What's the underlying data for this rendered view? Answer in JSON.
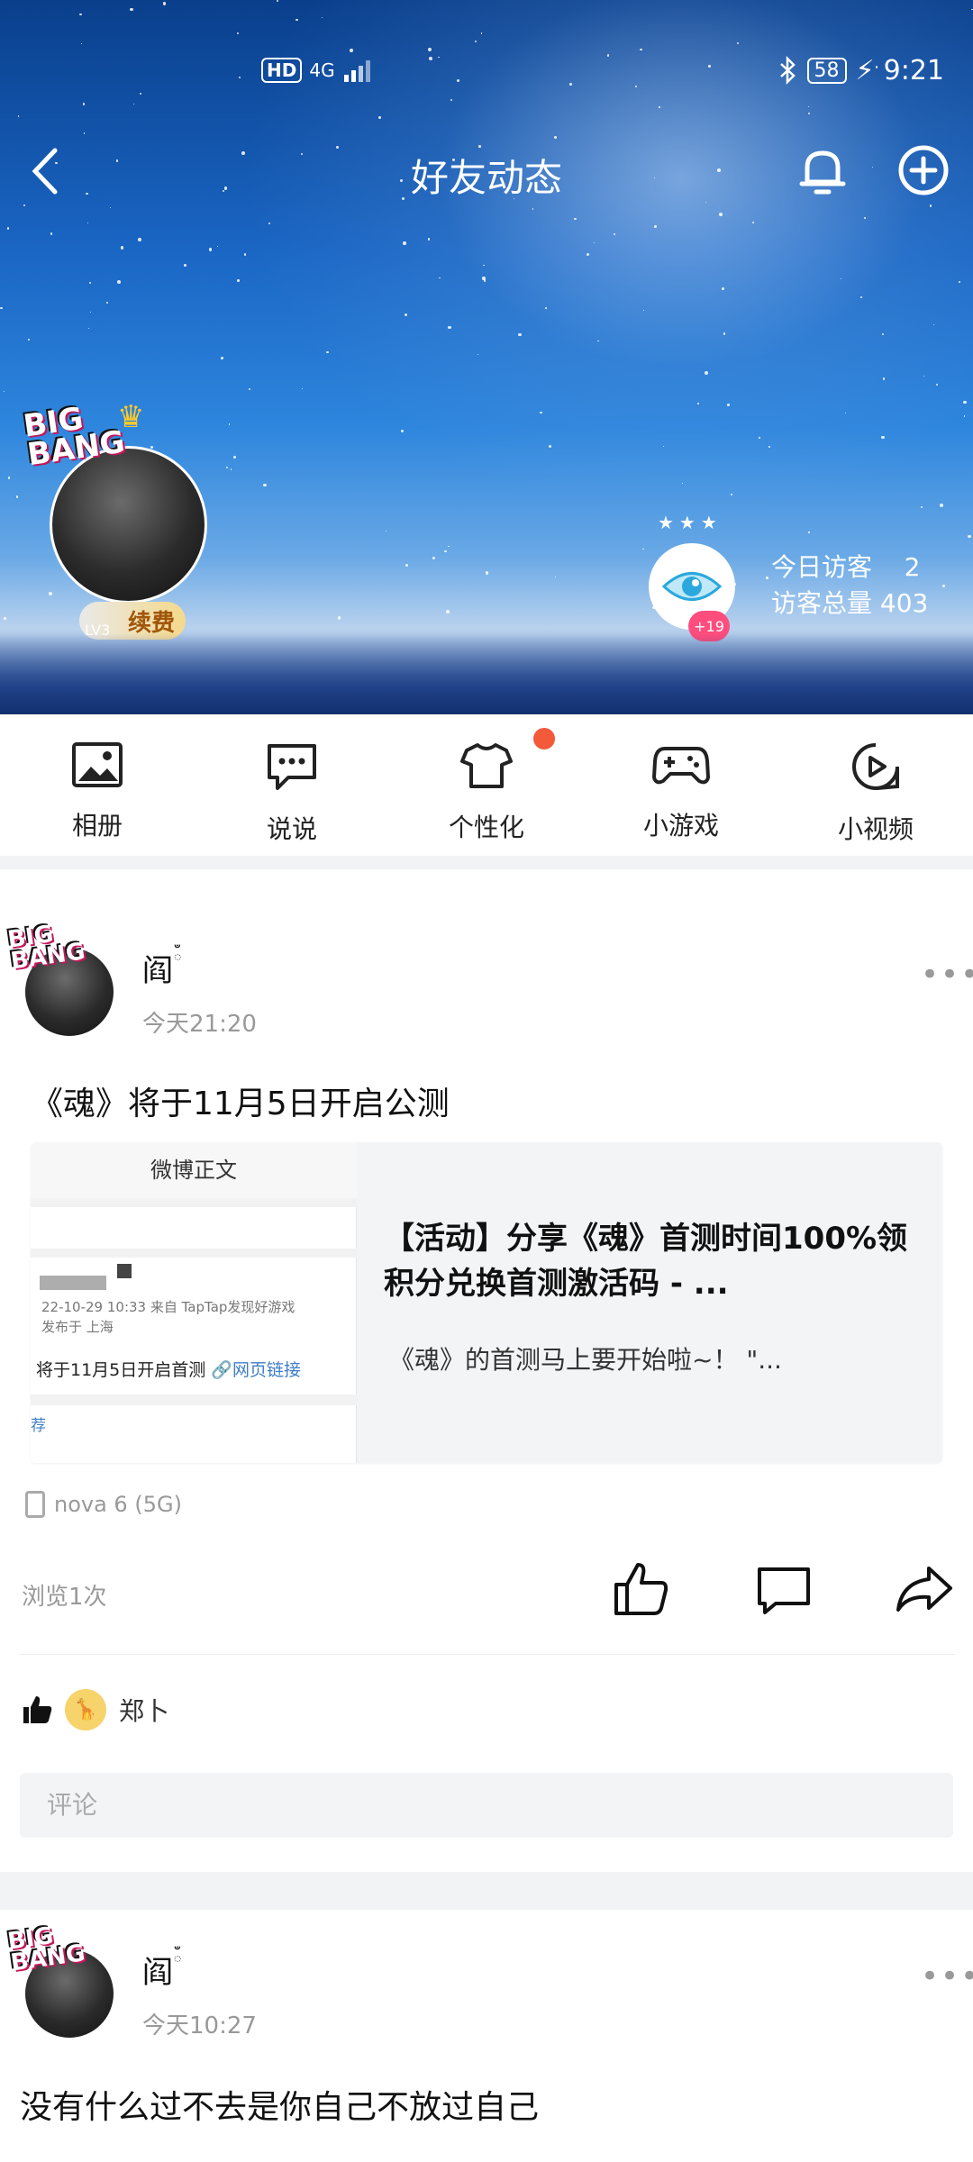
{
  "status_bar": {
    "hd": "HD",
    "network": "4G",
    "battery": "58",
    "time": "9:21"
  },
  "nav": {
    "title": "好友动态"
  },
  "profile": {
    "logo_text": "BIG BANG",
    "level": "LV3",
    "vip_label": "续费"
  },
  "visitors": {
    "today_label": "今日访客",
    "today_count": "2",
    "total_label": "访客总量",
    "total_count": "403",
    "badge": "+19"
  },
  "menu": {
    "items": [
      {
        "label": "相册",
        "icon": "photo-icon"
      },
      {
        "label": "说说",
        "icon": "chat-bubble-icon"
      },
      {
        "label": "个性化",
        "icon": "tshirt-icon"
      },
      {
        "label": "小游戏",
        "icon": "gamepad-icon"
      },
      {
        "label": "小视频",
        "icon": "play-icon"
      }
    ]
  },
  "post1": {
    "author": "阎",
    "time": "今天21:20",
    "text": "《魂》将于11月5日开启公测",
    "card": {
      "thumb_header": "微博正文",
      "thumb_line1": "22-10-29 10:33  来自 TapTap发现好游戏",
      "thumb_line2": "发布于 上海",
      "thumb_line3": "将于11月5日开启首测",
      "thumb_link": "网页链接",
      "thumb_line4": "荐",
      "title": "【活动】分享《魂》首测时间100%领积分兑换首测激活码 - ...",
      "desc": "《魂》的首测马上要开始啦~！  \"..."
    },
    "device": "nova 6 (5G)",
    "views": "浏览1次",
    "liker": "郑卜",
    "comment_placeholder": "评论"
  },
  "post2": {
    "author": "阎",
    "time": "今天10:27",
    "text": "没有什么过不去是你自己不放过自己"
  }
}
